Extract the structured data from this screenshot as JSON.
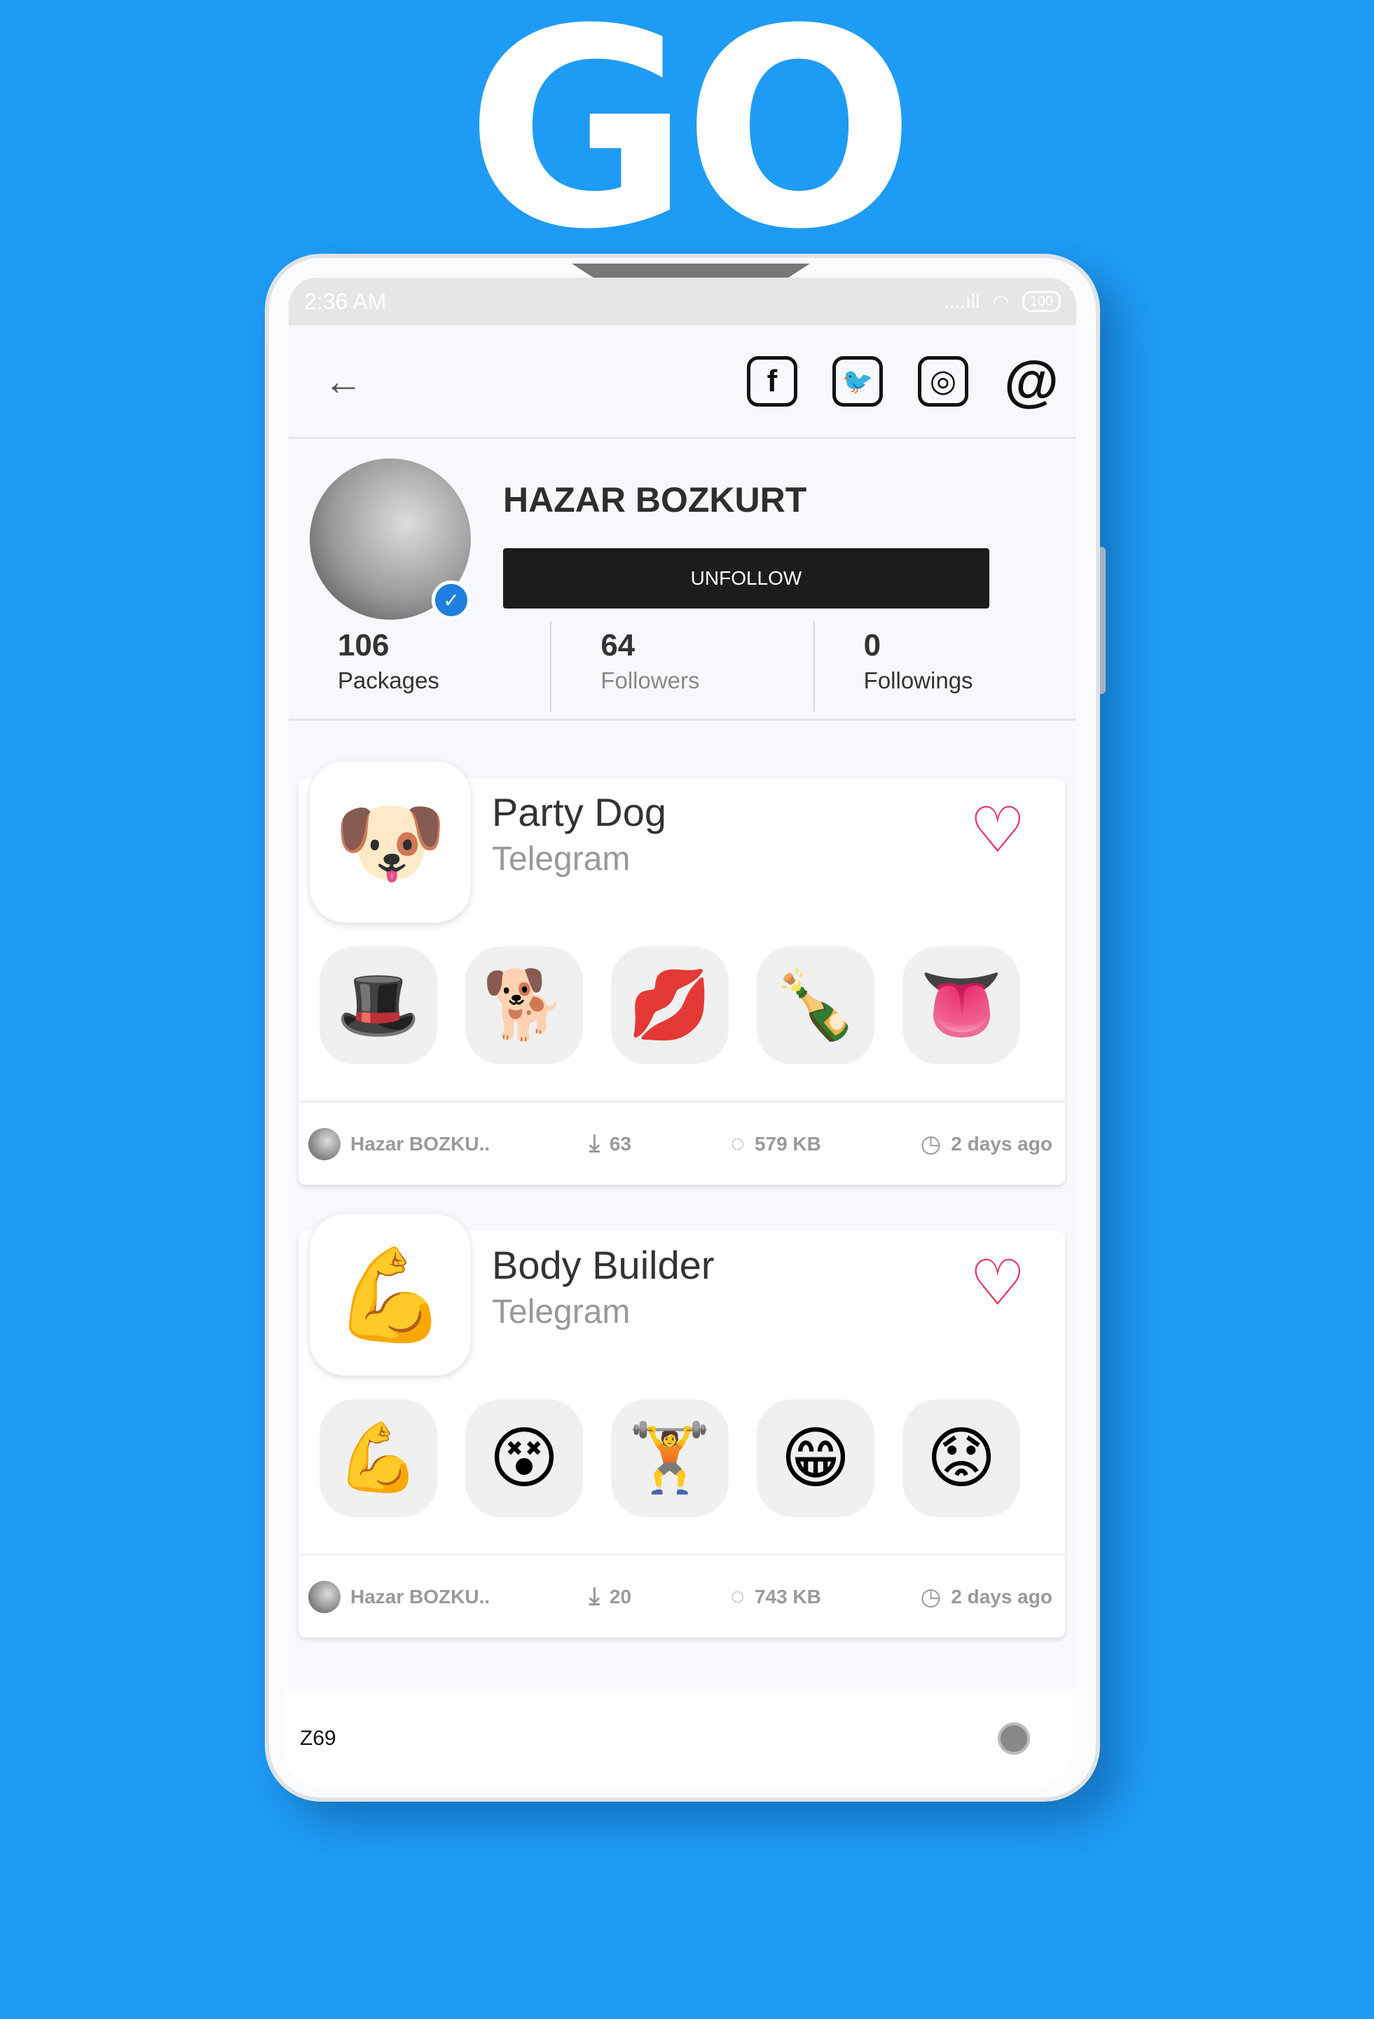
{
  "brand": {
    "logo_text": "GO",
    "background_color": "#1e9cf5"
  },
  "status_bar": {
    "time": "2:36 AM",
    "signal": "....ıll",
    "battery": "100"
  },
  "header": {
    "back_icon": "arrow-left-icon",
    "social": [
      {
        "name": "facebook",
        "glyph": "f"
      },
      {
        "name": "twitter",
        "glyph": "🐦"
      },
      {
        "name": "instagram",
        "glyph": "◎"
      },
      {
        "name": "email",
        "glyph": "@"
      }
    ]
  },
  "profile": {
    "name": "HAZAR BOZKURT",
    "verified": true,
    "action_label": "UNFOLLOW",
    "stats": [
      {
        "value": "106",
        "label": "Packages"
      },
      {
        "value": "64",
        "label": "Followers"
      },
      {
        "value": "0",
        "label": "Followings"
      }
    ]
  },
  "packages": [
    {
      "title": "Party Dog",
      "platform": "Telegram",
      "thumb": "🐶",
      "stickers": [
        "🎩",
        "🐕",
        "💋",
        "🍾",
        "👅"
      ],
      "author": "Hazar BOZKU..",
      "downloads": "63",
      "size": "579 KB",
      "updated": "2 days ago",
      "liked": true
    },
    {
      "title": "Body Builder",
      "platform": "Telegram",
      "thumb": "💪",
      "stickers": [
        "💪",
        "😵",
        "🏋️",
        "😁",
        "😟"
      ],
      "author": "Hazar BOZKU..",
      "downloads": "20",
      "size": "743 KB",
      "updated": "2 days ago",
      "liked": true
    }
  ],
  "nav_bar": {
    "label": "Z69"
  }
}
